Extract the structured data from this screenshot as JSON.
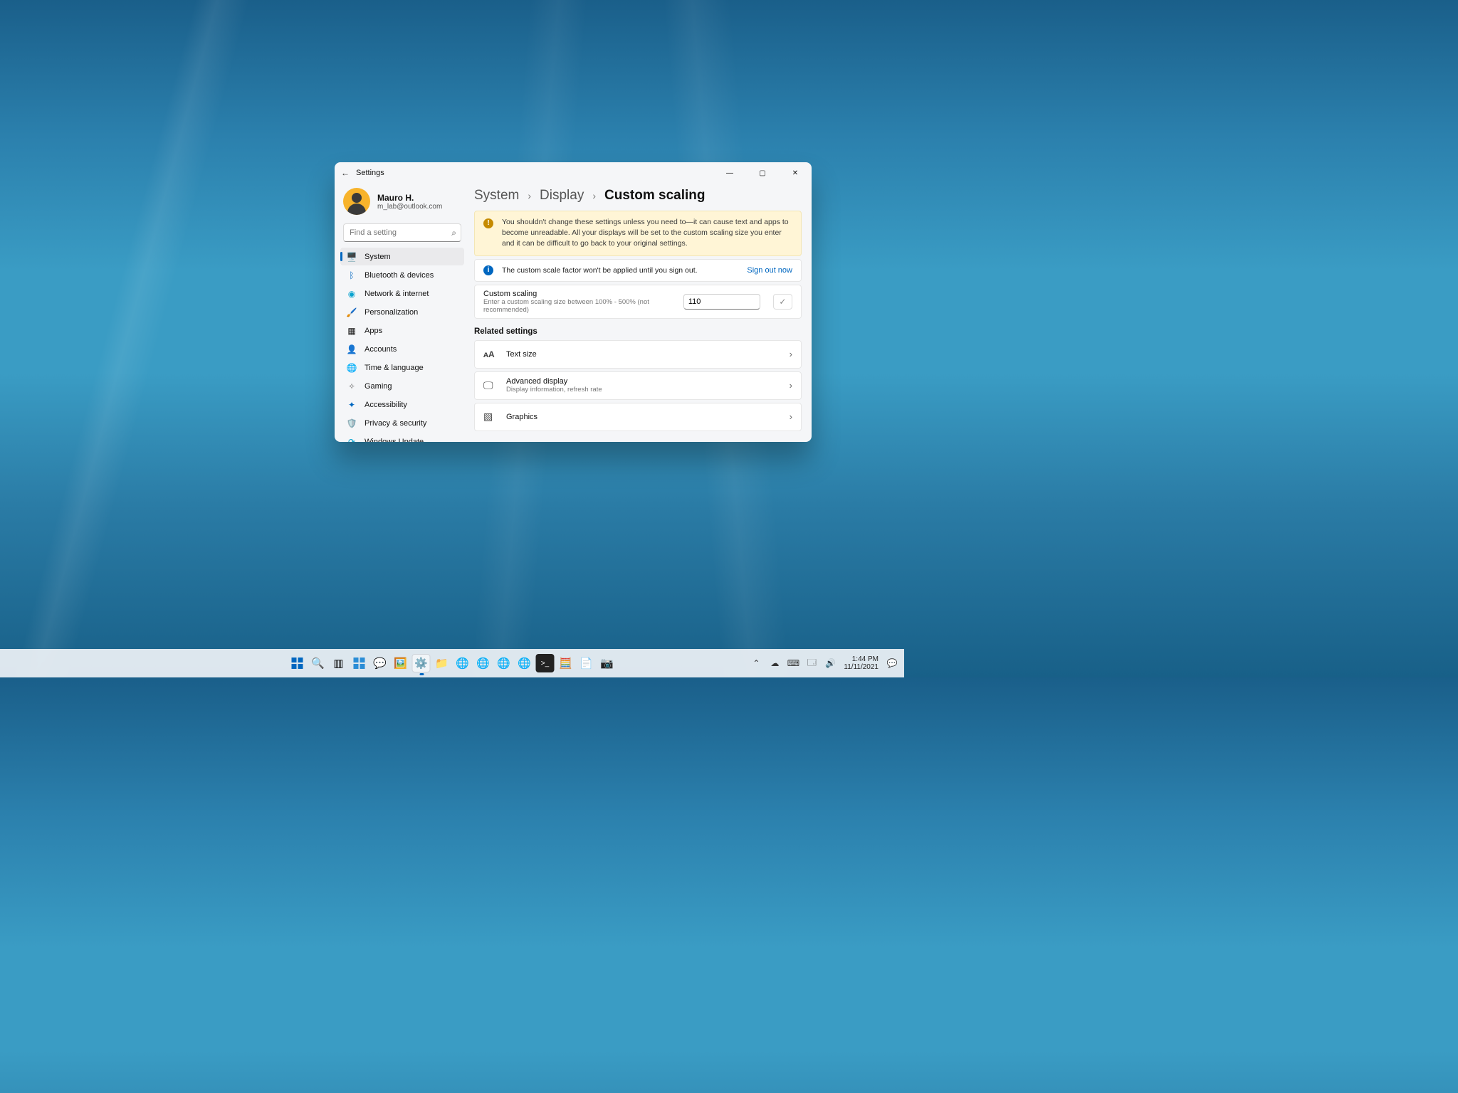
{
  "window": {
    "title": "Settings",
    "user_name": "Mauro H.",
    "user_email": "m_lab@outlook.com"
  },
  "search": {
    "placeholder": "Find a setting"
  },
  "nav": {
    "system": "System",
    "bluetooth": "Bluetooth & devices",
    "network": "Network & internet",
    "personalization": "Personalization",
    "apps": "Apps",
    "accounts": "Accounts",
    "time": "Time & language",
    "gaming": "Gaming",
    "accessibility": "Accessibility",
    "privacy": "Privacy & security",
    "update": "Windows Update"
  },
  "breadcrumb": {
    "l1": "System",
    "l2": "Display",
    "cur": "Custom scaling"
  },
  "warning": "You shouldn't change these settings unless you need to—it can cause text and apps to become unreadable. All your displays will be set to the custom scaling size you enter and it can be difficult to go back to your original settings.",
  "info_text": "The custom scale factor won't be applied until you sign out.",
  "signout": "Sign out now",
  "custom": {
    "label": "Custom scaling",
    "sub": "Enter a custom scaling size between 100% - 500% (not recommended)",
    "value": "110"
  },
  "related_heading": "Related settings",
  "related": {
    "text_size": "Text size",
    "advanced": "Advanced display",
    "advanced_sub": "Display information, refresh rate",
    "graphics": "Graphics"
  },
  "tray": {
    "time": "1:44 PM",
    "date": "11/11/2021"
  }
}
